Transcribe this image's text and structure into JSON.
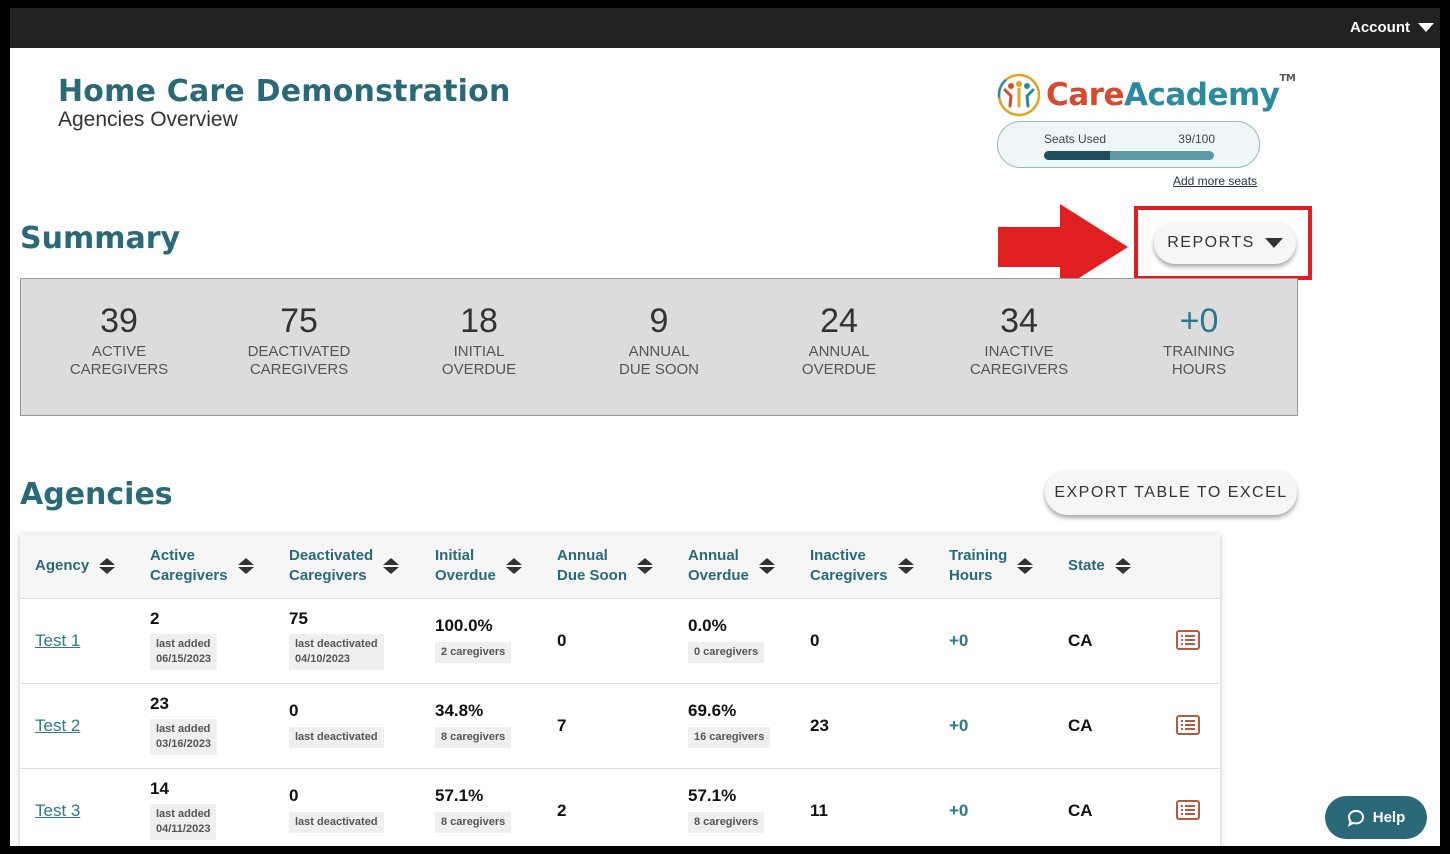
{
  "topbar": {
    "account_label": "Account"
  },
  "header": {
    "org_name": "Home Care Demonstration",
    "page_subtitle": "Agencies Overview"
  },
  "brand": {
    "name_care": "Care",
    "name_academy": "Academy",
    "tm": "TM",
    "seats_label": "Seats Used",
    "seats_value": "39/100",
    "seats_fraction": 0.39,
    "add_seats_label": "Add more seats"
  },
  "summary": {
    "heading": "Summary",
    "reports_label": "REPORTS",
    "stats": [
      {
        "value": "39",
        "line1": "ACTIVE",
        "line2": "CAREGIVERS"
      },
      {
        "value": "75",
        "line1": "DEACTIVATED",
        "line2": "CAREGIVERS"
      },
      {
        "value": "18",
        "line1": "INITIAL",
        "line2": "OVERDUE"
      },
      {
        "value": "9",
        "line1": "ANNUAL",
        "line2": "DUE SOON"
      },
      {
        "value": "24",
        "line1": "ANNUAL",
        "line2": "OVERDUE"
      },
      {
        "value": "34",
        "line1": "INACTIVE",
        "line2": "CAREGIVERS"
      },
      {
        "value": "+0",
        "line1": "TRAINING",
        "line2": "HOURS"
      }
    ]
  },
  "agencies": {
    "heading": "Agencies",
    "export_label": "EXPORT TABLE TO EXCEL",
    "columns": [
      {
        "l1": "Agency",
        "l2": ""
      },
      {
        "l1": "Active",
        "l2": "Caregivers"
      },
      {
        "l1": "Deactivated",
        "l2": "Caregivers"
      },
      {
        "l1": "Initial",
        "l2": "Overdue"
      },
      {
        "l1": "Annual",
        "l2": "Due Soon"
      },
      {
        "l1": "Annual",
        "l2": "Overdue"
      },
      {
        "l1": "Inactive",
        "l2": "Caregivers"
      },
      {
        "l1": "Training",
        "l2": "Hours"
      },
      {
        "l1": "State",
        "l2": ""
      }
    ],
    "rows": [
      {
        "name": "Test 1",
        "active": "2",
        "active_note": "last added",
        "active_date": "06/15/2023",
        "deact": "75",
        "deact_note": "last deactivated",
        "deact_date": "04/10/2023",
        "initial": "100.0%",
        "initial_note": "2 caregivers",
        "due_soon": "0",
        "annual_overdue": "0.0%",
        "annual_note": "0 caregivers",
        "inactive": "0",
        "hours": "+0",
        "state": "CA"
      },
      {
        "name": "Test 2",
        "active": "23",
        "active_note": "last added",
        "active_date": "03/16/2023",
        "deact": "0",
        "deact_note": "last deactivated",
        "deact_date": "",
        "initial": "34.8%",
        "initial_note": "8 caregivers",
        "due_soon": "7",
        "annual_overdue": "69.6%",
        "annual_note": "16 caregivers",
        "inactive": "23",
        "hours": "+0",
        "state": "CA"
      },
      {
        "name": "Test 3",
        "active": "14",
        "active_note": "last added",
        "active_date": "04/11/2023",
        "deact": "0",
        "deact_note": "last deactivated",
        "deact_date": "",
        "initial": "57.1%",
        "initial_note": "8 caregivers",
        "due_soon": "2",
        "annual_overdue": "57.1%",
        "annual_note": "8 caregivers",
        "inactive": "11",
        "hours": "+0",
        "state": "CA"
      }
    ]
  },
  "help": {
    "label": "Help"
  },
  "colors": {
    "teal": "#2a6a78",
    "accent_red": "#e02020",
    "brand_orange": "#d84a2e"
  }
}
